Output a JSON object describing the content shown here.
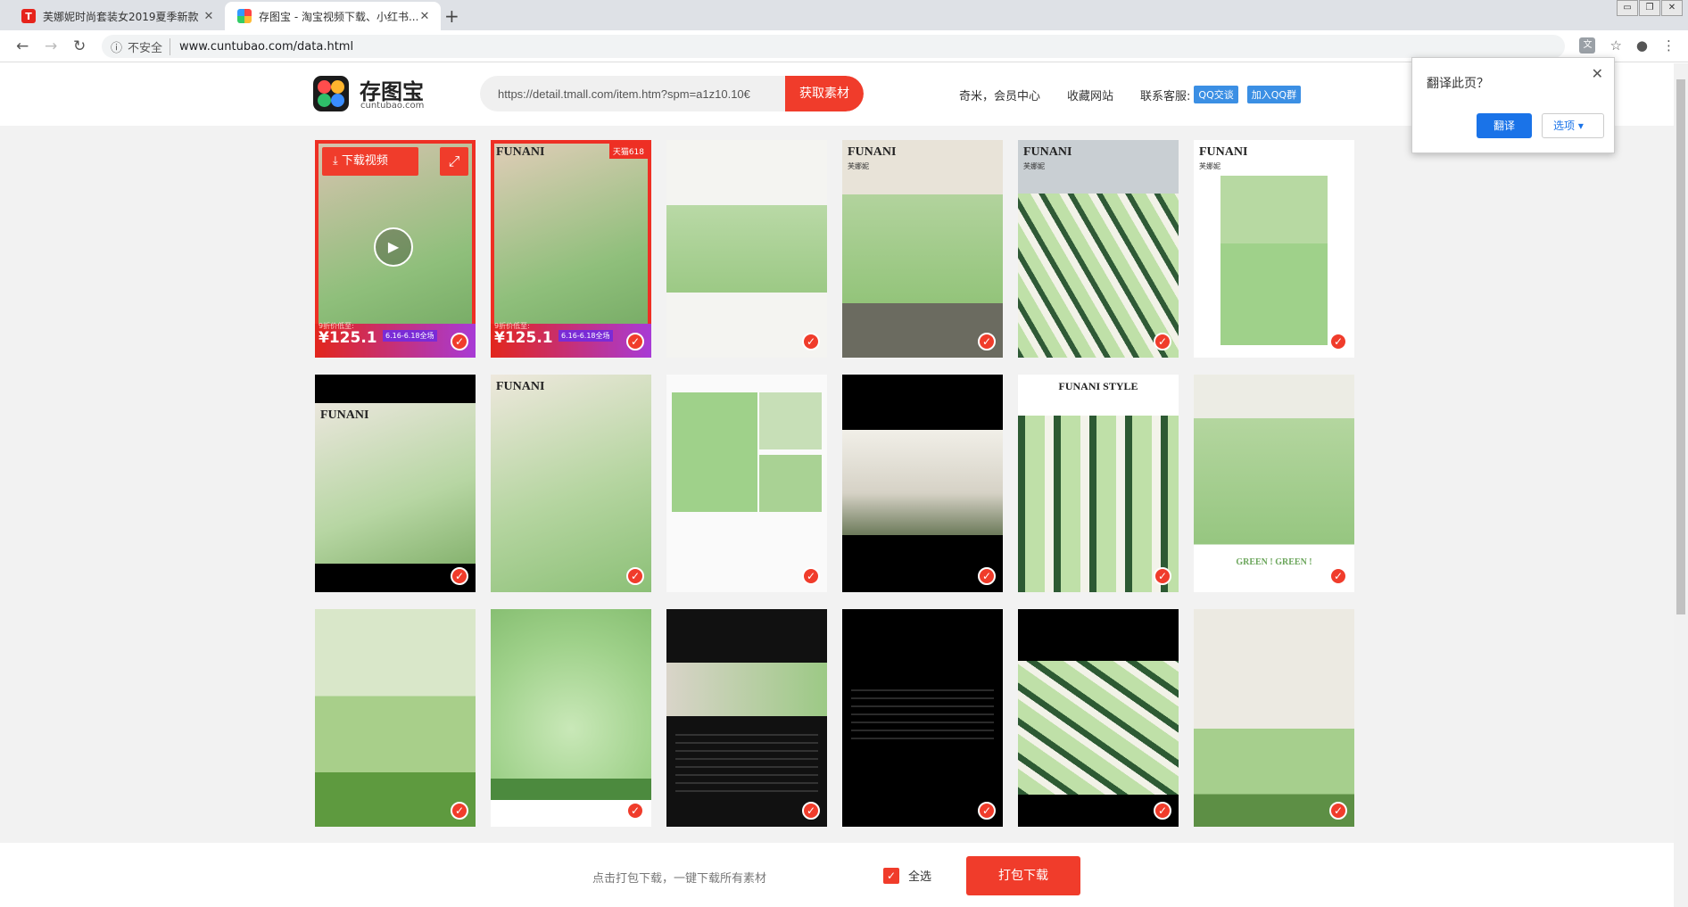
{
  "browser": {
    "tabs": [
      {
        "title": "芙娜妮时尚套装女2019夏季新款",
        "favicon": "T"
      },
      {
        "title": "存图宝 - 淘宝视频下载、小红书..."
      }
    ],
    "new_tab": "+",
    "security_label": "不安全",
    "url": "www.cuntubao.com/data.html"
  },
  "site": {
    "brand": "存图宝",
    "brand_sub": "cuntubao.com",
    "search_value": "https://detail.tmall.com/item.htm?spm=a1z10.10€",
    "search_button": "获取素材",
    "links": [
      "奇米，会员中心",
      "收藏网站",
      "联系客服:"
    ],
    "qq_chat": "QQ交谈",
    "qq_group": "加入QQ群"
  },
  "translate_popup": {
    "title": "翻译此页？",
    "translate_button": "翻译",
    "options_button": "选项"
  },
  "grid": {
    "first_item": {
      "download_video": "下载视频",
      "price_note": "9折价低至:",
      "price": "¥125.1",
      "promo": "6.16-6.18全场"
    },
    "second_badge": "天猫618",
    "brand_overlay": "FUNANI",
    "brand_sub": "芙娜妮",
    "style_title": "FUNANI STYLE",
    "green_text": "GREEN ! GREEN !"
  },
  "footer": {
    "hint": "点击打包下载，一键下载所有素材",
    "select_all": "全选",
    "pack_download": "打包下载"
  },
  "colors": {
    "accent": "#f03c2b",
    "page_bg": "#f2f2f2",
    "mint": "#9fd18a"
  }
}
